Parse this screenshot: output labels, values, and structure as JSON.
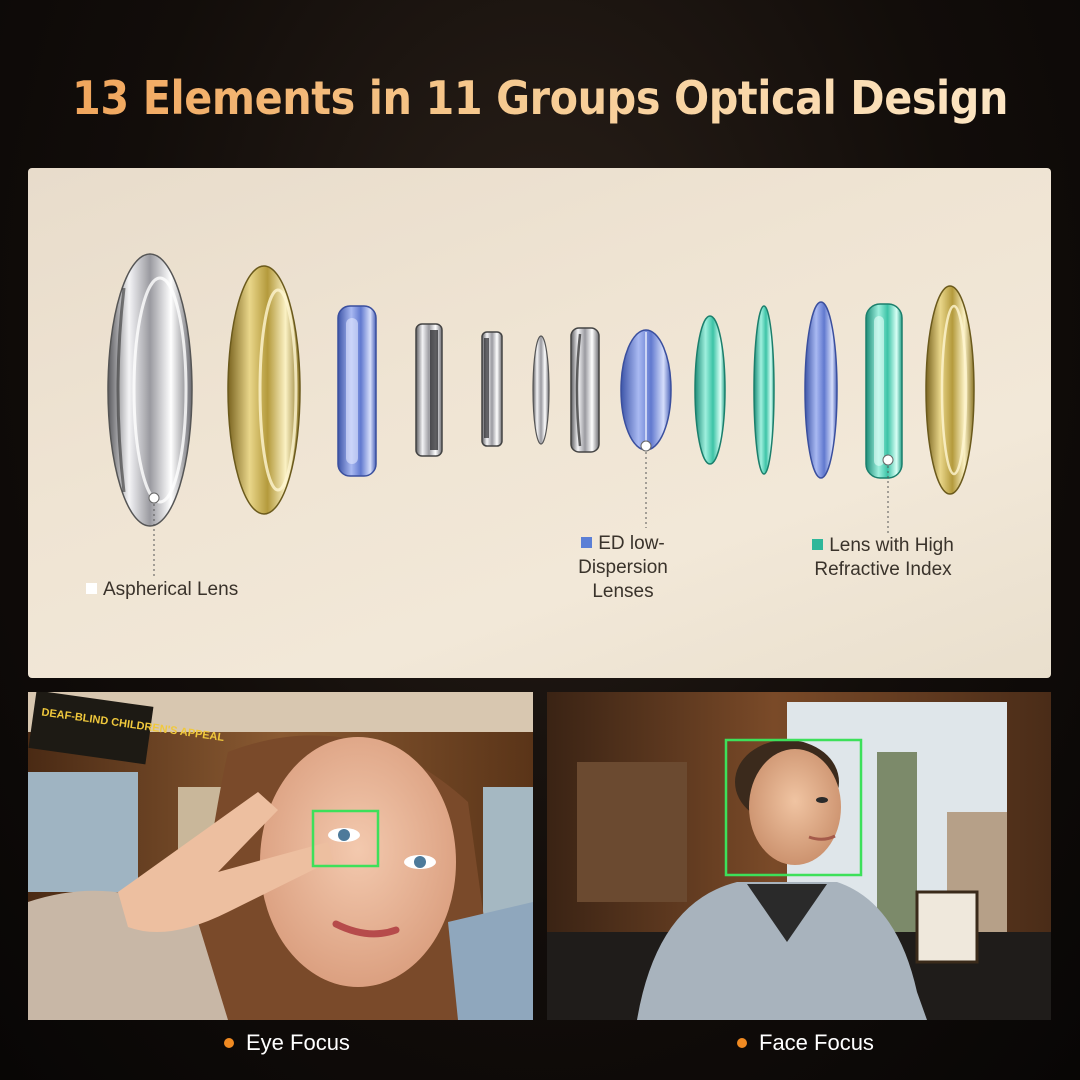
{
  "title": "13 Elements in 11 Groups Optical Design",
  "callouts": {
    "aspherical": {
      "label": "Aspherical Lens",
      "color": "#ffffff"
    },
    "ed": {
      "line1": "ED low-Dispersion",
      "line2": "Lenses",
      "color": "#5b7fd6"
    },
    "high_index": {
      "line1": "Lens with High",
      "line2": "Refractive Index",
      "color": "#2fb79a"
    }
  },
  "photos": {
    "left": {
      "caption": "Eye Focus",
      "sign_text": "DEAF-BLIND CHILDREN'S APPEAL",
      "focus_color": "#3de05a"
    },
    "right": {
      "caption": "Face Focus",
      "focus_color": "#3de05a"
    }
  },
  "lens_elements": [
    {
      "material": "silver",
      "icon": "aspherical-lens-icon"
    },
    {
      "material": "gold",
      "icon": "lens-icon"
    },
    {
      "material": "blue",
      "icon": "lens-icon"
    },
    {
      "material": "silver",
      "icon": "lens-icon"
    },
    {
      "material": "silver",
      "icon": "lens-icon"
    },
    {
      "material": "silver",
      "icon": "lens-icon"
    },
    {
      "material": "silver",
      "icon": "lens-icon"
    },
    {
      "material": "blue",
      "icon": "ed-lens-icon"
    },
    {
      "material": "teal",
      "icon": "lens-icon"
    },
    {
      "material": "teal",
      "icon": "lens-icon"
    },
    {
      "material": "blue",
      "icon": "lens-icon"
    },
    {
      "material": "teal",
      "icon": "high-index-lens-icon"
    },
    {
      "material": "gold",
      "icon": "lens-icon"
    }
  ]
}
